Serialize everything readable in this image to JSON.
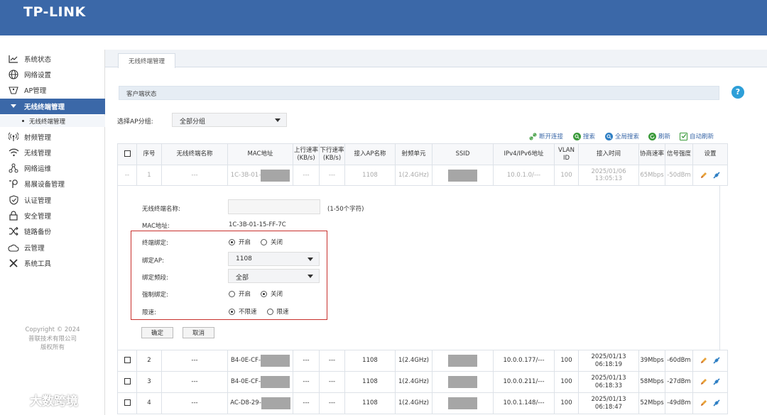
{
  "header": {
    "logo": "TP-LINK",
    "bg_color": "#3b68a8"
  },
  "sidebar": {
    "items": [
      {
        "label": "系统状态",
        "icon": "chart-line-icon"
      },
      {
        "label": "网络设置",
        "icon": "globe-icon"
      },
      {
        "label": "AP管理",
        "icon": "ap-icon"
      },
      {
        "label": "无线终端管理",
        "icon": "caret-down-icon",
        "active": true
      },
      {
        "label": "射频管理",
        "icon": "radio-tower-icon"
      },
      {
        "label": "无线管理",
        "icon": "wifi-icon"
      },
      {
        "label": "网络运维",
        "icon": "network-icon"
      },
      {
        "label": "易展设备管理",
        "icon": "easymesh-icon"
      },
      {
        "label": "认证管理",
        "icon": "shield-check-icon"
      },
      {
        "label": "安全管理",
        "icon": "lock-icon"
      },
      {
        "label": "链路备份",
        "icon": "shuffle-icon"
      },
      {
        "label": "云管理",
        "icon": "cloud-icon"
      },
      {
        "label": "系统工具",
        "icon": "tools-icon"
      }
    ],
    "sub_item": "无线终端管理",
    "copyright": [
      "Copyright © 2024",
      "普联技术有限公司",
      "版权所有"
    ]
  },
  "tab": {
    "label": "无线终端管理"
  },
  "section": {
    "title": "客户端状态",
    "help": "?"
  },
  "filter": {
    "label": "选择AP分组:",
    "value": "全部分组"
  },
  "toolbar": {
    "disconnect": "断开连接",
    "search": "搜索",
    "global_search": "全局搜索",
    "refresh": "刷新",
    "auto_refresh": "自动刷新"
  },
  "table": {
    "headers": [
      "序号",
      "无线终端名称",
      "MAC地址",
      "上行速率(KB/s)",
      "下行速率(KB/s)",
      "接入AP名称",
      "射频单元",
      "SSID",
      "IPv4/IPv6地址",
      "VLAN ID",
      "接入时间",
      "协商速率",
      "信号强度",
      "设置"
    ],
    "header_up": [
      "上行速率",
      "(KB/s)"
    ],
    "header_down": [
      "下行速率",
      "(KB/s)"
    ],
    "header_vlan": [
      "VLAN",
      "ID"
    ],
    "row1": {
      "check": "--",
      "no": "1",
      "name": "---",
      "mac": "1C-3B-01-",
      "up": "---",
      "down": "---",
      "ap": "1108",
      "radio": "1(2.4GHz)",
      "ip": "10.0.1.0/---",
      "vlan": "100",
      "time1": "2025/01/06",
      "time2": "13:05:13",
      "rate": "65Mbps",
      "signal": "-50dBm"
    },
    "rows": [
      {
        "no": "2",
        "name": "---",
        "mac": "B4-0E-CF-",
        "up": "---",
        "down": "---",
        "ap": "1108",
        "radio": "1(2.4GHz)",
        "ip": "10.0.0.177/---",
        "vlan": "100",
        "time1": "2025/01/13",
        "time2": "06:18:19",
        "rate": "39Mbps",
        "signal": "-60dBm"
      },
      {
        "no": "3",
        "name": "---",
        "mac": "B4-0E-CF-",
        "up": "---",
        "down": "---",
        "ap": "1108",
        "radio": "1(2.4GHz)",
        "ip": "10.0.0.211/---",
        "vlan": "100",
        "time1": "2025/01/13",
        "time2": "06:18:33",
        "rate": "58Mbps",
        "signal": "-27dBm"
      },
      {
        "no": "4",
        "name": "---",
        "mac": "AC-D8-29-",
        "up": "---",
        "down": "---",
        "ap": "1108",
        "radio": "1(2.4GHz)",
        "ip": "10.0.1.148/---",
        "vlan": "100",
        "time1": "2025/01/13",
        "time2": "06:18:47",
        "rate": "52Mbps",
        "signal": "-49dBm"
      }
    ]
  },
  "edit_panel": {
    "name_label": "无线终端名称:",
    "name_value": "",
    "name_hint": "(1-50个字符)",
    "mac_label": "MAC地址:",
    "mac_value": "1C-3B-01-15-FF-7C",
    "bind_label": "终端绑定:",
    "bind_on": "开启",
    "bind_off": "关闭",
    "bind_ap_label": "绑定AP:",
    "bind_ap_value": "1108",
    "bind_band_label": "绑定频段:",
    "bind_band_value": "全部",
    "force_label": "强制绑定:",
    "force_on": "开启",
    "force_off": "关闭",
    "limit_label": "限速:",
    "limit_none": "不限速",
    "limit_on": "限速",
    "ok": "确定",
    "cancel": "取消"
  },
  "watermark": "大数跨境"
}
